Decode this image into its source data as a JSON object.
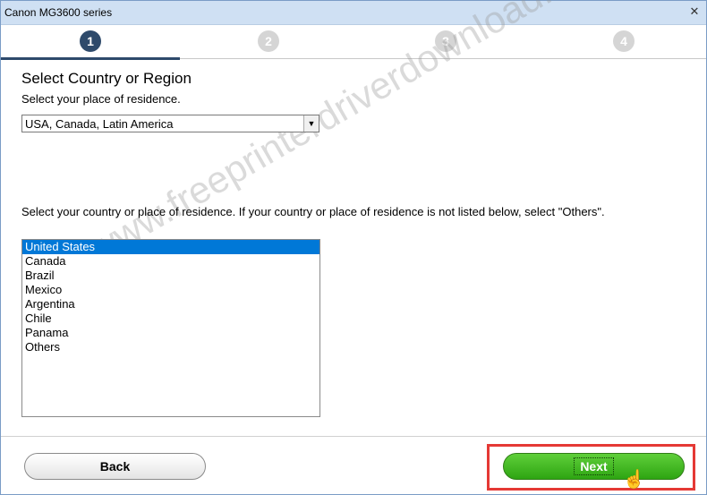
{
  "window": {
    "title": "Canon MG3600 series",
    "close_symbol": "✕"
  },
  "steps": [
    "1",
    "2",
    "3",
    "4"
  ],
  "heading": "Select Country or Region",
  "residence_prompt": "Select your place of residence.",
  "region_select": {
    "value": "USA, Canada, Latin America"
  },
  "country_prompt": "Select your country or place of residence. If your country or place of residence is not listed below, select \"Others\".",
  "countries": [
    "United States",
    "Canada",
    "Brazil",
    "Mexico",
    "Argentina",
    "Chile",
    "Panama",
    "Others"
  ],
  "selected_country": "United States",
  "buttons": {
    "back": "Back",
    "next": "Next"
  },
  "watermark": "www.freeprinterdriverdownload.org",
  "colors": {
    "accent": "#2e4a6b",
    "selection": "#0078d7",
    "next_green": "#2ea512",
    "highlight": "#e53935"
  }
}
